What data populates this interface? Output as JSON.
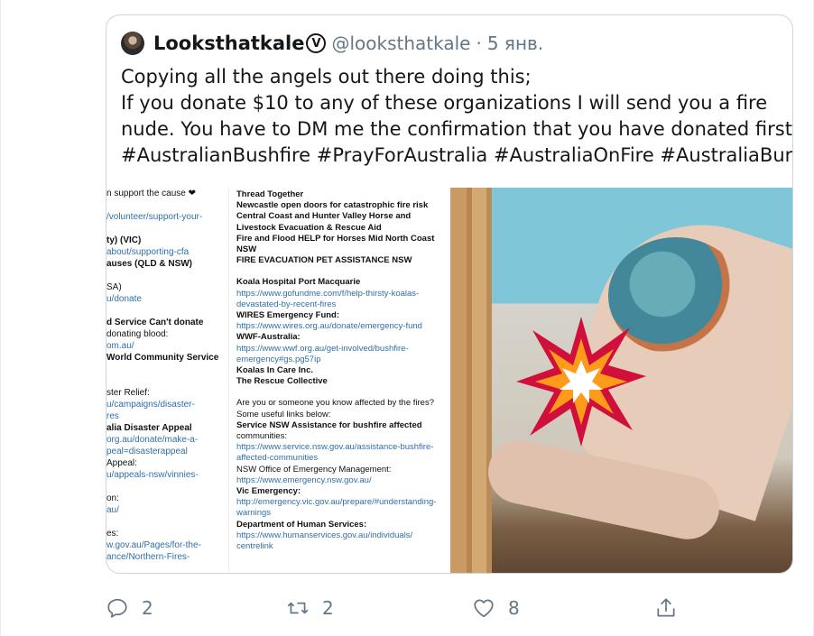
{
  "quoted_tweet": {
    "author_name": "Looksthatkale",
    "verified_glyph": "V",
    "handle": "@looksthatkale",
    "separator": "·",
    "date": "5 янв.",
    "text_lines": [
      "Copying all the angels out there doing this;",
      "If you donate $10 to any of these organizations I will send you a fire",
      "nude. You have to DM me the confirmation that you have donated first.",
      "#AustralianBushfire #PrayForAustralia #AustraliaOnFire #AustraliaBurns"
    ]
  },
  "media": {
    "left_panel_lines": [
      {
        "t": "n support the cause ❤",
        "s": "plain"
      },
      {
        "t": "",
        "s": "gap"
      },
      {
        "t": "/volunteer/support-your-",
        "s": "lnk"
      },
      {
        "t": "",
        "s": "gap"
      },
      {
        "t": "ty) (VIC)",
        "s": "b",
        "extra": " (VIC)"
      },
      {
        "t": "about/supporting-cfa",
        "s": "lnk"
      },
      {
        "t": "auses (QLD & NSW)",
        "s": "b"
      },
      {
        "t": "",
        "s": "gap"
      },
      {
        "t": "SA)",
        "s": "plain"
      },
      {
        "t": "u/donate",
        "s": "lnk"
      },
      {
        "t": "",
        "s": "gap"
      },
      {
        "t": "d Service Can't donate",
        "s": "b"
      },
      {
        "t": " donating blood:",
        "s": "plain"
      },
      {
        "t": "om.au/",
        "s": "lnk"
      },
      {
        "t": " World Community Service",
        "s": "b"
      },
      {
        "t": "",
        "s": "gap"
      },
      {
        "t": "",
        "s": "gap"
      },
      {
        "t": "ster Relief:",
        "s": "plain"
      },
      {
        "t": "u/campaigns/disaster-",
        "s": "lnk"
      },
      {
        "t": "res",
        "s": "lnk"
      },
      {
        "t": "alia Disaster Appeal",
        "s": "b"
      },
      {
        "t": "org.au/donate/make-a-",
        "s": "lnk"
      },
      {
        "t": "peal=disasterappeal",
        "s": "lnk"
      },
      {
        "t": " Appeal:",
        "s": "plain"
      },
      {
        "t": "u/appeals-nsw/vinnies-",
        "s": "lnk"
      },
      {
        "t": "",
        "s": "gap"
      },
      {
        "t": "on:",
        "s": "plain"
      },
      {
        "t": "au/",
        "s": "lnk"
      },
      {
        "t": "",
        "s": "gap"
      },
      {
        "t": "es:",
        "s": "plain"
      },
      {
        "t": "w.gov.au/Pages/for-the-",
        "s": "lnk"
      },
      {
        "t": "ance/Northern-Fires-",
        "s": "lnk"
      }
    ],
    "mid_panel_lines": [
      {
        "t": "Thread Together",
        "s": "b"
      },
      {
        "t": "Newcastle open doors for catastrophic fire risk",
        "s": "b"
      },
      {
        "t": "Central Coast and Hunter Valley Horse and",
        "s": "b"
      },
      {
        "t": "Livestock Evacuation & Rescue Aid",
        "s": "b"
      },
      {
        "t": "Fire and Flood HELP for Horses Mid North Coast",
        "s": "b"
      },
      {
        "t": "NSW",
        "s": "b"
      },
      {
        "t": "FIRE EVACUATION PET ASSISTANCE NSW",
        "s": "b"
      },
      {
        "t": "",
        "s": "gap2"
      },
      {
        "t": "Koala Hospital Port Macquarie",
        "s": "b"
      },
      {
        "t": "https://www.gofundme.com/f/help-thirsty-koalas-",
        "s": "lnk"
      },
      {
        "t": "devastated-by-recent-fires",
        "s": "lnk"
      },
      {
        "t": "WIRES Emergency Fund:",
        "s": "b"
      },
      {
        "t": "https://www.wires.org.au/donate/emergency-fund",
        "s": "lnk"
      },
      {
        "t": "WWF-Australia:",
        "s": "b"
      },
      {
        "t": "https://www.wwf.org.au/get-involved/bushfire-",
        "s": "lnk"
      },
      {
        "t": "emergency#gs.pg57ip",
        "s": "lnk"
      },
      {
        "t": "Koalas In Care Inc.",
        "s": "b"
      },
      {
        "t": "The Rescue Collective",
        "s": "b"
      },
      {
        "t": "",
        "s": "gap2"
      },
      {
        "t": "Are you or someone you know affected by the fires?",
        "s": "plain"
      },
      {
        "t": "Some useful links below:",
        "s": "plain"
      },
      {
        "t": "Service NSW Assistance for bushfire affected",
        "s": "b"
      },
      {
        "t": "communities:",
        "s": "plain"
      },
      {
        "t": "https://www.service.nsw.gov.au/assistance-bushfire-",
        "s": "lnk"
      },
      {
        "t": "affected-communities",
        "s": "lnk"
      },
      {
        "t": "NSW Office of Emergency Management:",
        "s": "plain"
      },
      {
        "t": "https://www.emergency.nsw.gov.au/",
        "s": "lnk"
      },
      {
        "t": "Vic Emergency:",
        "s": "b"
      },
      {
        "t": "http://emergency.vic.gov.au/prepare/#understanding-",
        "s": "lnk"
      },
      {
        "t": "warnings",
        "s": "lnk"
      },
      {
        "t": "Department of Human Services:",
        "s": "b"
      },
      {
        "t": "https://www.humanservices.gov.au/individuals/",
        "s": "lnk"
      },
      {
        "t": "centrelink",
        "s": "lnk"
      }
    ],
    "photo_censor_icon": "collision-emoji-icon"
  },
  "actions": {
    "reply": {
      "icon": "reply-icon",
      "count": "2"
    },
    "retweet": {
      "icon": "retweet-icon",
      "count": "2"
    },
    "like": {
      "icon": "heart-icon",
      "count": "8"
    },
    "share": {
      "icon": "share-icon"
    }
  },
  "colors": {
    "text": "#14171a",
    "muted": "#657786",
    "border": "#ccd6dd",
    "link": "#2f6fa8"
  }
}
